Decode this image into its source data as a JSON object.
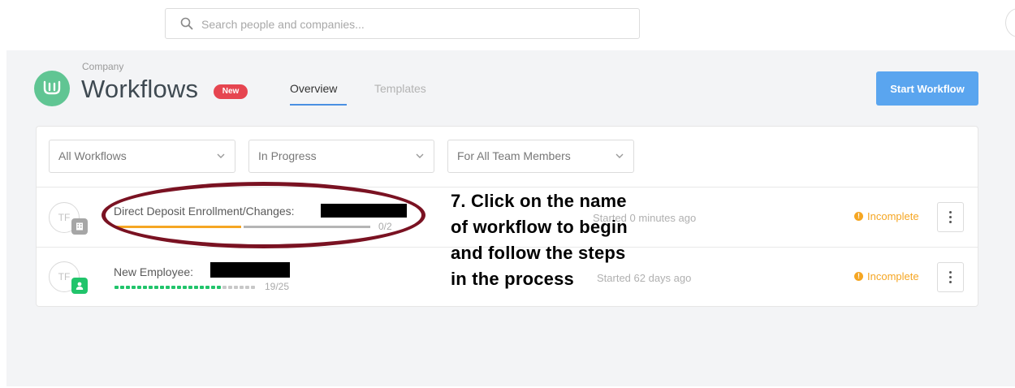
{
  "search": {
    "placeholder": "Search people and companies..."
  },
  "header": {
    "breadcrumb": "Company",
    "title": "Workflows",
    "badge": "New",
    "tabs": [
      {
        "label": "Overview",
        "active": true
      },
      {
        "label": "Templates",
        "active": false
      }
    ],
    "start_button": "Start Workflow"
  },
  "filters": [
    {
      "label": "All Workflows"
    },
    {
      "label": "In Progress"
    },
    {
      "label": "For All Team Members"
    }
  ],
  "workflows": [
    {
      "avatar": "TF",
      "badge_icon": "building-icon",
      "name": "Direct Deposit Enrollment/Changes:",
      "progress": {
        "done": 0,
        "total": 2,
        "label": "0/2"
      },
      "started": "Started 0 minutes ago",
      "status": "Incomplete"
    },
    {
      "avatar": "TF",
      "badge_icon": "person-icon",
      "name": "New Employee:",
      "progress": {
        "done": 19,
        "total": 25,
        "label": "19/25"
      },
      "started": "Started 62 days ago",
      "status": "Incomplete"
    }
  ],
  "annotation": {
    "text": "7. Click on the name\nof workflow to begin\nand follow the steps\nin the process"
  },
  "colors": {
    "accent_blue": "#5aa5ef",
    "brand_green": "#60c593",
    "badge_red": "#e64550",
    "status_orange": "#f5a623",
    "progress_green": "#21c46b",
    "annotation_maroon": "#7a1222"
  }
}
